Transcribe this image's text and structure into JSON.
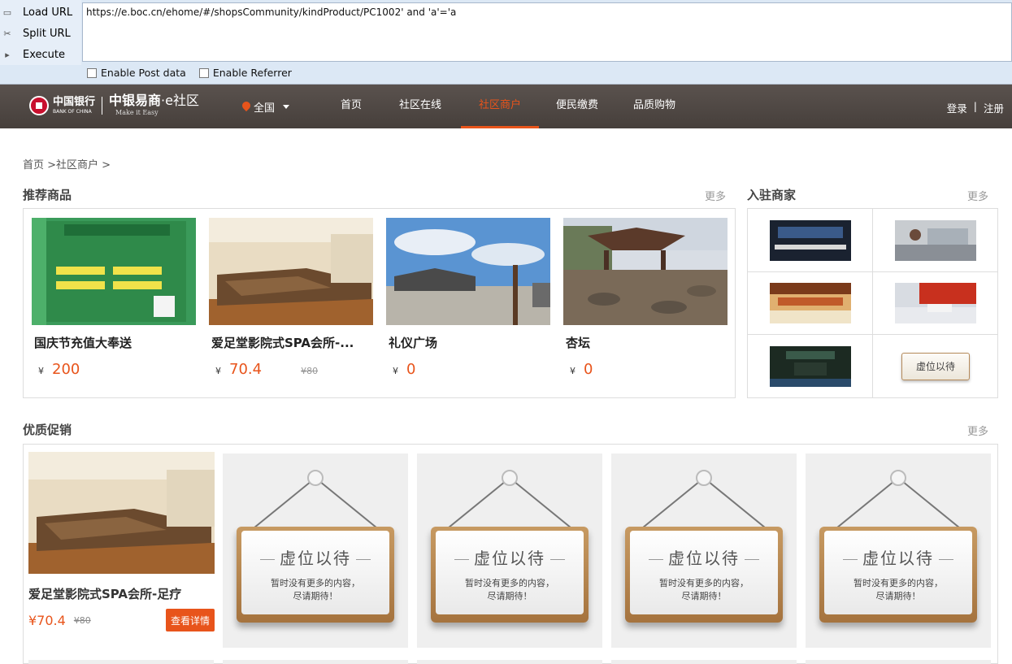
{
  "hackbar": {
    "buttons": [
      "Load URL",
      "Split URL",
      "Execute"
    ],
    "url": "https://e.boc.cn/ehome/#/shopsCommunity/kindProduct/PC1002' and 'a'='a",
    "options": [
      "Enable Post data",
      "Enable Referrer"
    ]
  },
  "header": {
    "boc_name": "中国银行",
    "boc_en": "BANK OF CHINA",
    "brand_cn": "中银易商",
    "brand_suffix": "·e社区",
    "brand_en": "Make it Easy",
    "region": "全国",
    "nav": [
      "首页",
      "社区在线",
      "社区商户",
      "便民缴费",
      "品质购物"
    ],
    "active_nav": "社区商户",
    "login": "登录",
    "divider": "|",
    "register": "注册"
  },
  "breadcrumb": "首页 >社区商户 >",
  "recommended": {
    "title": "推荐商品",
    "more": "更多",
    "items": [
      {
        "name": "国庆节充值大奉送",
        "currency": "¥",
        "price": "200",
        "old_price": ""
      },
      {
        "name": "爱足堂影院式SPA会所-...",
        "currency": "¥",
        "price": "70.4",
        "old_price": "¥80"
      },
      {
        "name": "礼仪广场",
        "currency": "¥",
        "price": "0",
        "old_price": ""
      },
      {
        "name": "杏坛",
        "currency": "¥",
        "price": "0",
        "old_price": ""
      }
    ]
  },
  "merchants": {
    "title": "入驻商家",
    "more": "更多",
    "placeholder": "虚位以待"
  },
  "promotions": {
    "title": "优质促销",
    "more": "更多",
    "first": {
      "name": "爱足堂影院式SPA会所-足疗",
      "price": "¥70.4",
      "old_price": "¥80",
      "button": "查看详情"
    },
    "placeholder_title": "虚位以待",
    "placeholder_line1": "暂时没有更多的内容，",
    "placeholder_line2": "尽请期待！"
  },
  "colors": {
    "accent": "#e8541b",
    "header_bg": "#4f4844",
    "hackbar_bg": "#dce8f5"
  }
}
